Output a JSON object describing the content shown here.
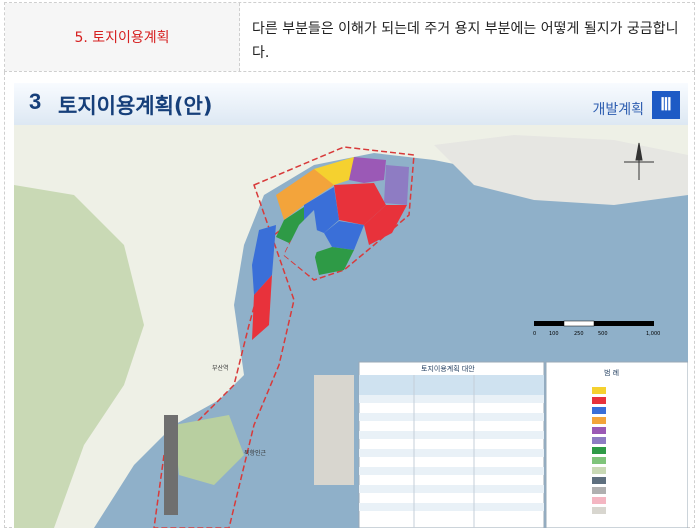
{
  "qa": {
    "question_label": "5. 토지이용계획",
    "answer_text": "다른 부분들은 이해가 되는데 주거 용지 부분에는 어떻게 될지가 궁금합니다."
  },
  "slide": {
    "number": "3",
    "title": "토지이용계획(안)",
    "section": "개발계획",
    "section_roman": "Ⅲ",
    "table_title": "토지이용계획 대안",
    "legend_title": "범 례",
    "scale_labels": [
      "0",
      "100",
      "250",
      "500",
      "1,000"
    ],
    "map_labels": [
      "부산역",
      "북항인근"
    ]
  },
  "colors": {
    "label_red": "#d62020",
    "title_blue": "#163f7a",
    "sea": "#8fb0c9",
    "land": "#f4f1e6"
  }
}
